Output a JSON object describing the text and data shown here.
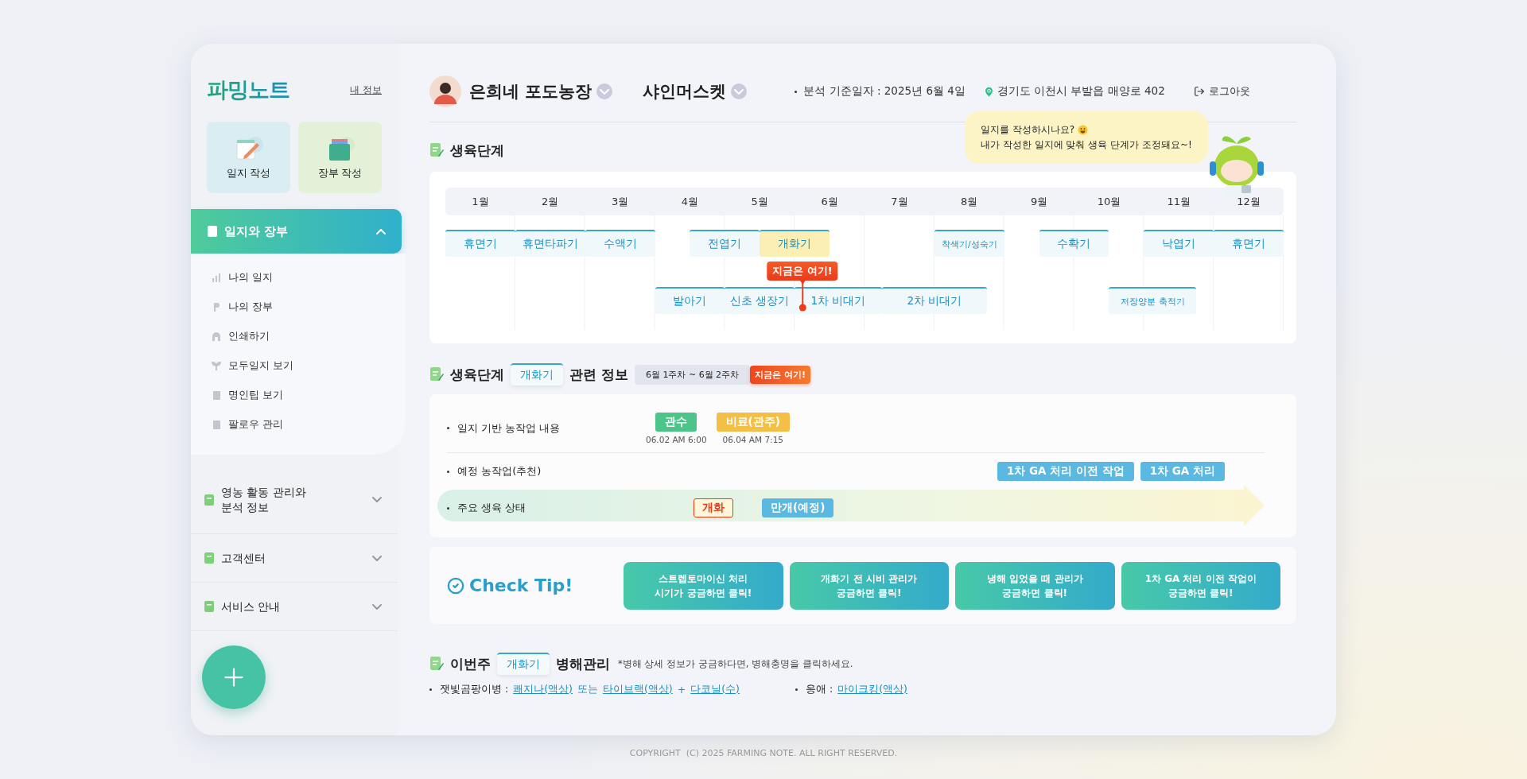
{
  "sidebar": {
    "logo": "파밍노트",
    "my_info": "내 정보",
    "quick_actions": [
      {
        "label": "일지 작성",
        "kind": "diary"
      },
      {
        "label": "장부 작성",
        "kind": "ledger"
      }
    ],
    "menu": [
      {
        "label": "일지와 장부",
        "expanded": true,
        "children": [
          {
            "label": "나의 일지",
            "kind": "chart"
          },
          {
            "label": "나의 장부",
            "kind": "p"
          },
          {
            "label": "인쇄하기",
            "kind": "print"
          },
          {
            "label": "모두일지 보기",
            "kind": "sprout"
          },
          {
            "label": "명인팁 보기",
            "kind": "doc"
          },
          {
            "label": "팔로우 관리",
            "kind": "doc"
          }
        ]
      },
      {
        "label": "영농 활동 관리와\n분석 정보",
        "expanded": false
      },
      {
        "label": "고객센터",
        "expanded": false
      },
      {
        "label": "서비스 안내",
        "expanded": false
      }
    ]
  },
  "header": {
    "farm": "은희네 포도농장",
    "crop": "샤인머스켓",
    "analysis_date": "분석 기준일자 : 2025년 6월 4일",
    "location": "경기도 이천시 부발읍 매양로 402",
    "logout": "로그아웃"
  },
  "bubble": {
    "lines": [
      "일지를 작성하시나요?",
      "내가 작성한 일지에 맞춰 생육 단계가 조정돼요~!"
    ]
  },
  "growth": {
    "title": "생육단계",
    "months": [
      "1월",
      "2월",
      "3월",
      "4월",
      "5월",
      "6월",
      "7월",
      "8월",
      "9월",
      "10월",
      "11월",
      "12월"
    ],
    "stages": [
      {
        "label": "휴면기",
        "current": false
      },
      {
        "label": "휴면타파기",
        "current": false
      },
      {
        "label": "수액기",
        "current": false
      },
      {
        "label": "전엽기",
        "current": false
      },
      {
        "label": "개화기",
        "current": true
      },
      {
        "label": "착색기/성숙기",
        "current": false
      },
      {
        "label": "수확기",
        "current": false
      },
      {
        "label": "낙엽기",
        "current": false
      },
      {
        "label": "휴면기",
        "current": false
      },
      {
        "label": "발아기",
        "current": false
      },
      {
        "label": "신초 생장기",
        "current": false
      },
      {
        "label": "1차 비대기",
        "current": false
      },
      {
        "label": "2차 비대기",
        "current": false
      },
      {
        "label": "저장양분 축적기",
        "current": false
      }
    ],
    "now_marker": "지금은 여기!"
  },
  "info": {
    "title_prefix": "생육단계",
    "stage_tag": "개화기",
    "title_suffix": "관련 정보",
    "period": "6월 1주차 ~ 6월 2주차",
    "now_badge": "지금은 여기!",
    "rows": [
      {
        "label": "일지 기반 농작업 내용",
        "kind": "log",
        "tags": [
          {
            "label": "관수",
            "time": "06.02 AM 6:00",
            "color": "#4cc48a"
          },
          {
            "label": "비료(관주)",
            "time": "06.04 AM 7:15",
            "color": "#f5bf45"
          }
        ]
      },
      {
        "label": "예정 농작업(추천)",
        "kind": "plan",
        "tags": [
          {
            "label": "1차 GA 처리 이전 작업",
            "color": "#5bb8e0"
          },
          {
            "label": "1차 GA 처리",
            "color": "#5bb8e0"
          }
        ]
      },
      {
        "label": "주요 생육 상태",
        "kind": "status",
        "tags": [
          {
            "label": "개화",
            "current": true
          },
          {
            "label": "만개(예정)",
            "current": false
          }
        ]
      }
    ]
  },
  "tip": {
    "title": "Check Tip!",
    "buttons": [
      {
        "lines": [
          "스트렙토마이신 처리",
          "시기가 궁금하면 클릭!"
        ]
      },
      {
        "lines": [
          "개화기 전 시비 관리가",
          "궁금하면 클릭!"
        ]
      },
      {
        "lines": [
          "냉해 입었을 때 관리가",
          "궁금하면 클릭!"
        ]
      },
      {
        "lines": [
          "1차 GA 처리 이전 작업이",
          "궁금하면 클릭!"
        ]
      }
    ]
  },
  "pest": {
    "title_prefix": "이번주",
    "stage_tag": "개화기",
    "title_suffix": "병해관리",
    "note": "*병해 상세 정보가 궁금하다면, 병해충명을 클릭하세요.",
    "items": [
      {
        "name": "잿빛곰팡이병 :",
        "parts": [
          {
            "kind": "link",
            "text": "쾌지나(액상)"
          },
          {
            "kind": "text",
            "text": "또는"
          },
          {
            "kind": "link",
            "text": "타이브랙(액상)"
          },
          {
            "kind": "text",
            "text": "+"
          },
          {
            "kind": "link",
            "text": "다코닐(수)"
          }
        ]
      },
      {
        "name": "응애 :",
        "parts": [
          {
            "kind": "link",
            "text": "마이크킹(액상)"
          }
        ]
      }
    ]
  },
  "footer": "COPYRIGHT  (C) 2025 FARMING NOTE. ALL RIGHT RESERVED."
}
